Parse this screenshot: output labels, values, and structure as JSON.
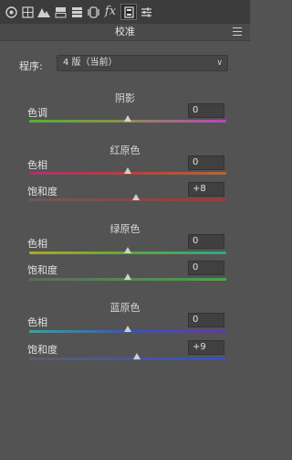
{
  "panel": {
    "title": "校准"
  },
  "process": {
    "label": "程序:",
    "value": "4 版（当前）"
  },
  "shadows": {
    "title": "阴影",
    "rows": [
      {
        "label": "色调",
        "value": "0",
        "level": 0
      }
    ]
  },
  "red_primary": {
    "title": "红原色",
    "rows": [
      {
        "label": "色相",
        "value": "0",
        "level": 0
      },
      {
        "label": "饱和度",
        "value": "+8",
        "level": 8
      }
    ]
  },
  "green_primary": {
    "title": "绿原色",
    "rows": [
      {
        "label": "色相",
        "value": "0",
        "level": 0
      },
      {
        "label": "饱和度",
        "value": "0",
        "level": 0
      }
    ]
  },
  "blue_primary": {
    "title": "蓝原色",
    "rows": [
      {
        "label": "色相",
        "value": "0",
        "level": 0
      },
      {
        "label": "饱和度",
        "value": "+9",
        "level": 9
      }
    ]
  },
  "slider_range": [
    -100,
    100
  ],
  "toolbar": {
    "icons": [
      "aperture-icon",
      "grid-icon",
      "mountain-icon",
      "split-panel-icon",
      "columns-icon",
      "lens-icon",
      "fx-icon",
      "calibration-icon",
      "presets-sliders-icon"
    ],
    "fx_label": "fx"
  },
  "colors": {
    "background": "#535353",
    "toolbar": "#3c3c3c"
  }
}
